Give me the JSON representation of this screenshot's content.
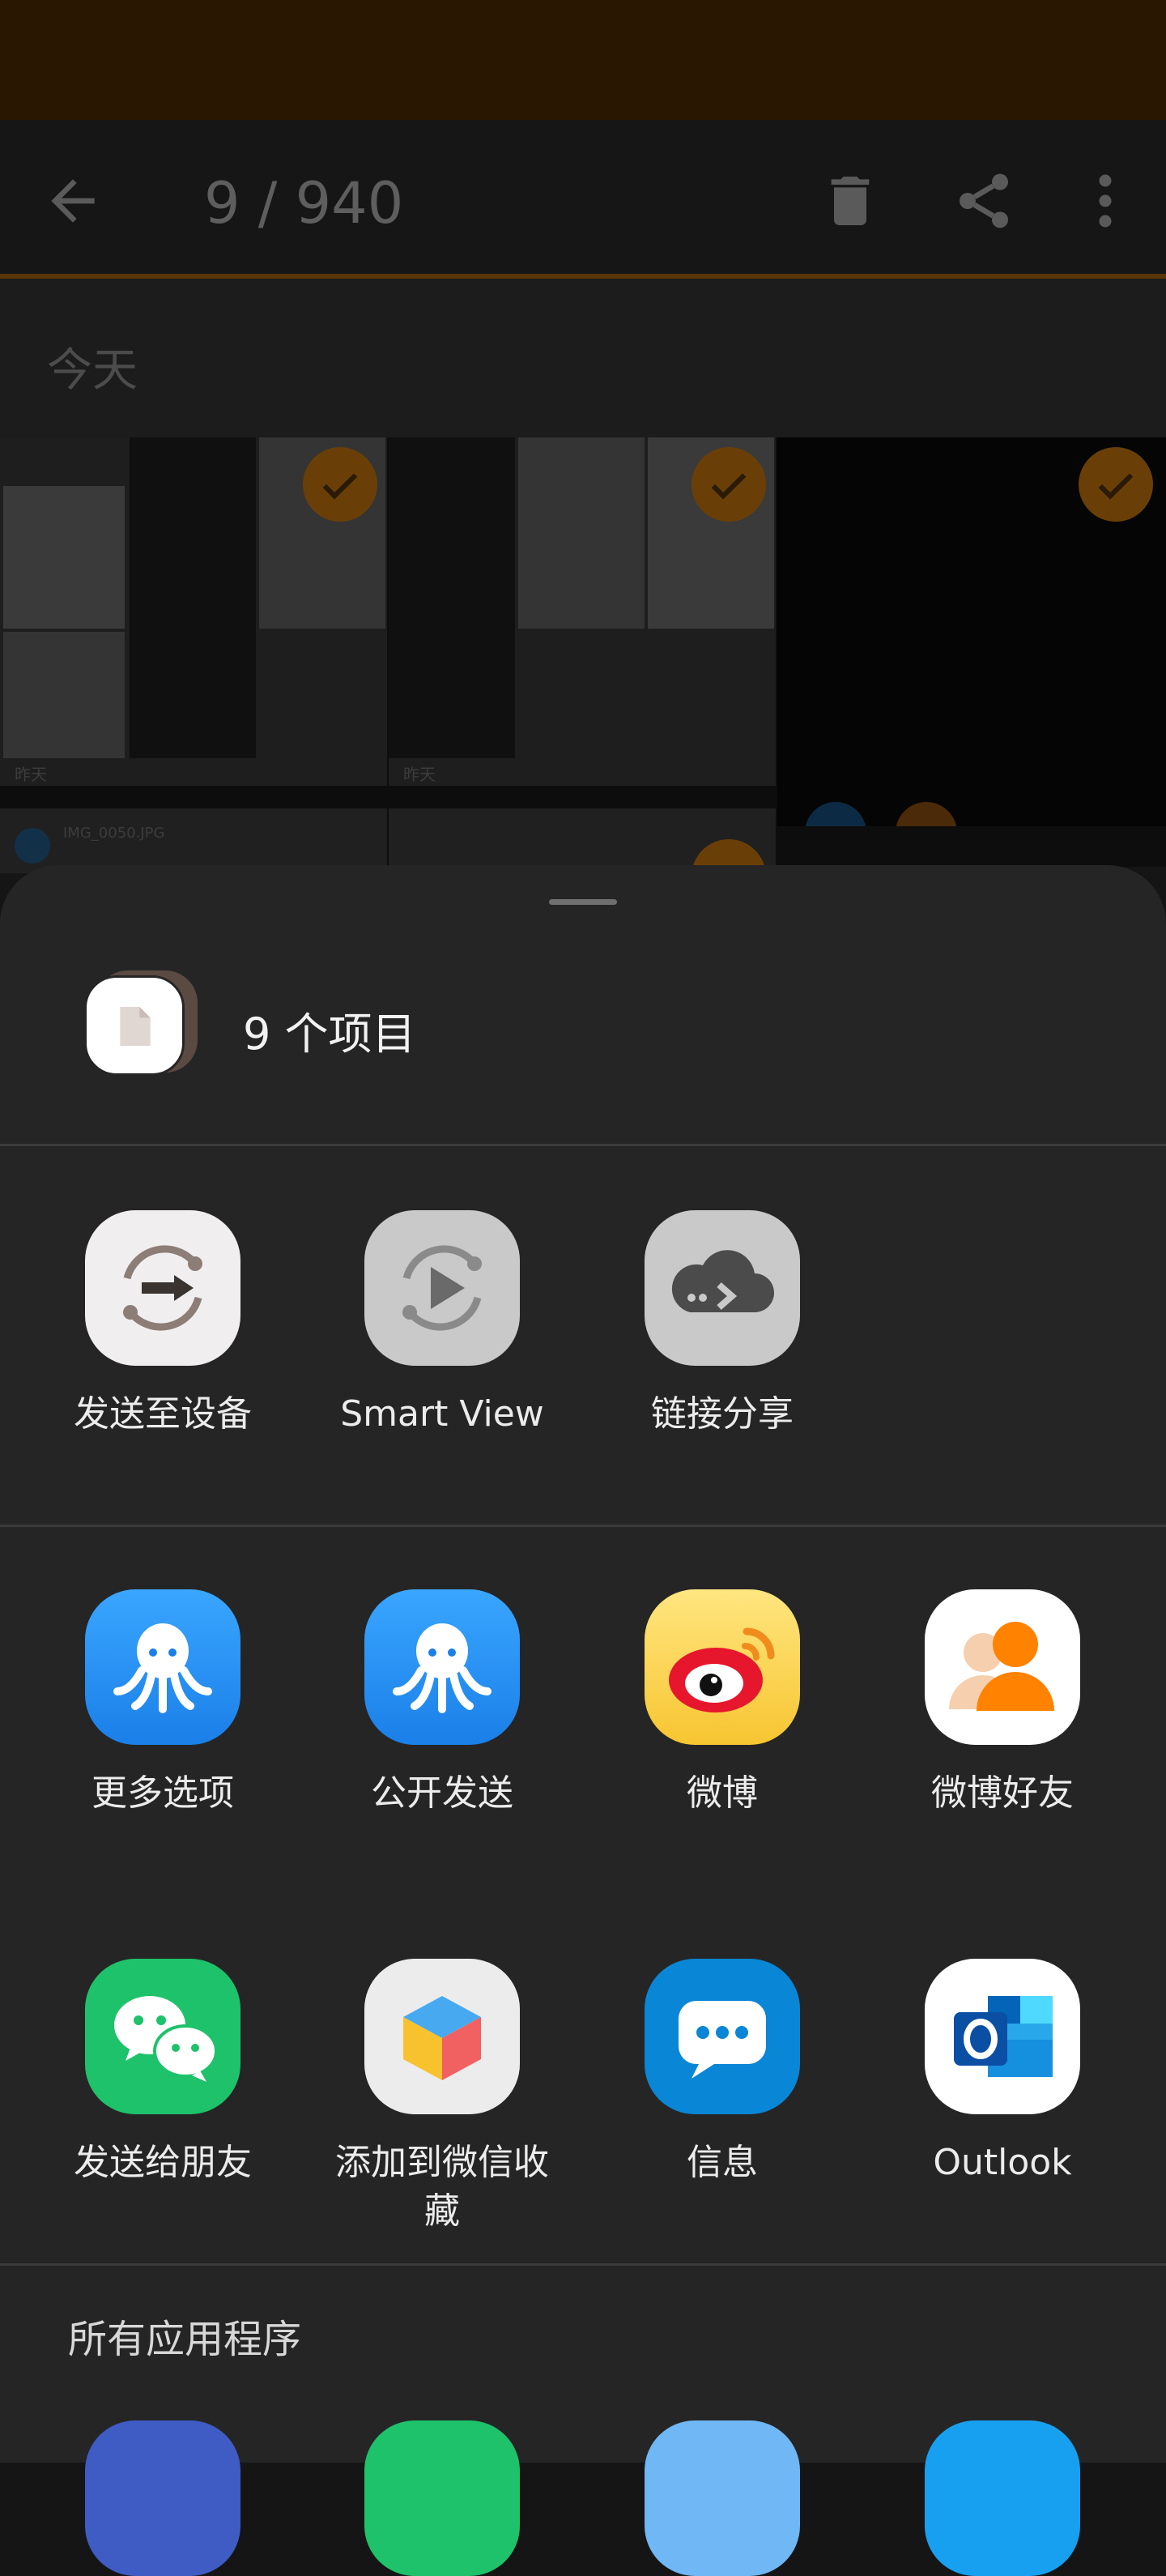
{
  "gallery": {
    "counter": "9 / 940",
    "section_title": "今天",
    "tile_labels": [
      "昨天",
      "昨天"
    ],
    "file_name_snippet": "IMG_0050.JPG",
    "colors": {
      "accent": "#f29111",
      "status_bar": "#2a1702"
    }
  },
  "share_sheet": {
    "header": {
      "title": "9 个项目",
      "icon": "file-icon"
    },
    "quick_actions": [
      {
        "label": "发送至设备",
        "icon": "send-to-device-icon"
      },
      {
        "label": "Smart View",
        "icon": "smart-view-icon"
      },
      {
        "label": "链接分享",
        "icon": "link-sharing-cloud-icon"
      }
    ],
    "apps_row1": [
      {
        "label": "更多选项",
        "icon": "octopus-icon"
      },
      {
        "label": "公开发送",
        "icon": "octopus-icon"
      },
      {
        "label": "微博",
        "icon": "weibo-icon"
      },
      {
        "label": "微博好友",
        "icon": "weibo-friends-icon"
      }
    ],
    "apps_row2": [
      {
        "label": "发送给朋友",
        "icon": "wechat-icon"
      },
      {
        "label": "添加到微信收藏",
        "icon": "wechat-favorites-cube-icon"
      },
      {
        "label": "信息",
        "icon": "messages-icon"
      },
      {
        "label": "Outlook",
        "icon": "outlook-icon"
      }
    ],
    "all_apps_title": "所有应用程序"
  }
}
